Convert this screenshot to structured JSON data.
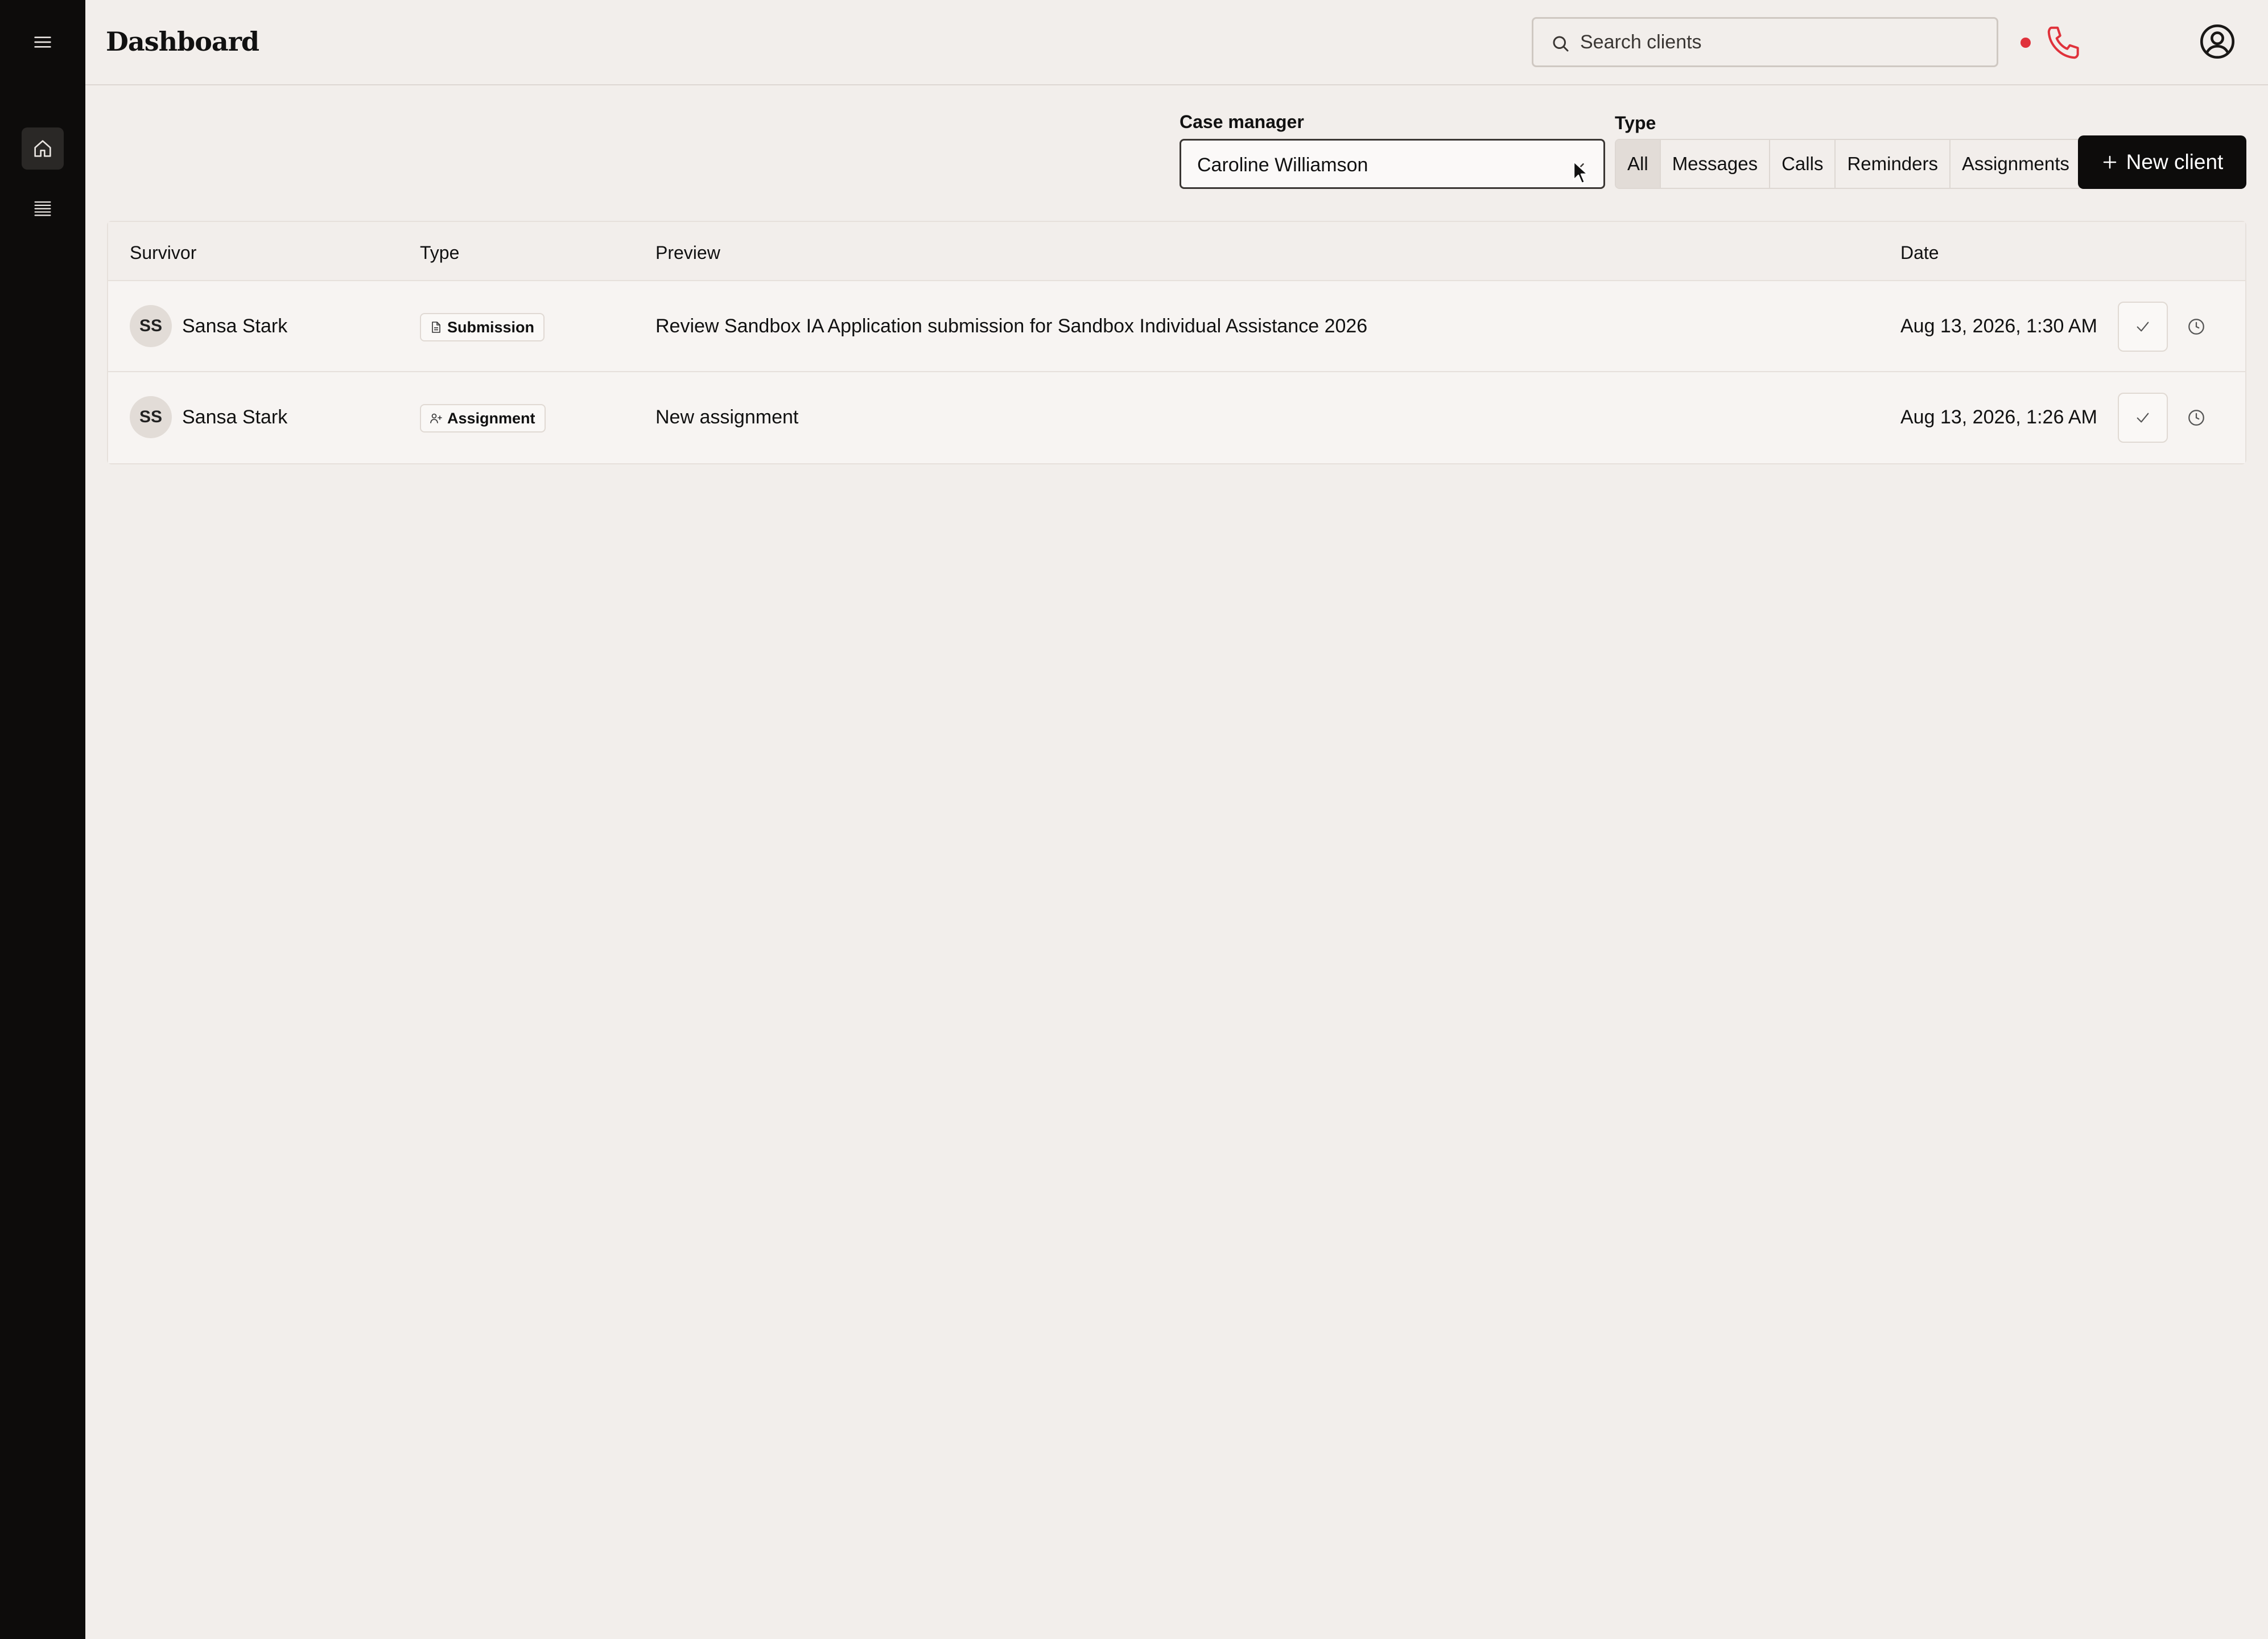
{
  "header": {
    "title": "Dashboard",
    "search_placeholder": "Search clients"
  },
  "sidebar": {
    "items": [
      {
        "icon": "menu-icon"
      },
      {
        "icon": "home-icon",
        "active": true
      },
      {
        "icon": "list-icon"
      }
    ]
  },
  "filters": {
    "case_manager_label": "Case manager",
    "case_manager_value": "Caroline Williamson",
    "type_label": "Type",
    "type_options": [
      "All",
      "Messages",
      "Calls",
      "Reminders",
      "Assignments"
    ],
    "type_selected": "All"
  },
  "new_client_label": "New client",
  "table": {
    "columns": [
      "Survivor",
      "Type",
      "Preview",
      "Date"
    ],
    "rows": [
      {
        "initials": "SS",
        "survivor": "Sansa Stark",
        "type": "Submission",
        "type_icon": "document-icon",
        "preview": "Review Sandbox IA Application submission for Sandbox Individual Assistance 2026",
        "date": "Aug 13, 2026, 1:30 AM"
      },
      {
        "initials": "SS",
        "survivor": "Sansa Stark",
        "type": "Assignment",
        "type_icon": "user-plus-icon",
        "preview": "New assignment",
        "date": "Aug 13, 2026, 1:26 AM"
      }
    ]
  },
  "colors": {
    "background": "#f2eeeb",
    "sidebar": "#0d0c0b",
    "primary_button": "#0d0c0b",
    "alert": "#e0323b"
  }
}
